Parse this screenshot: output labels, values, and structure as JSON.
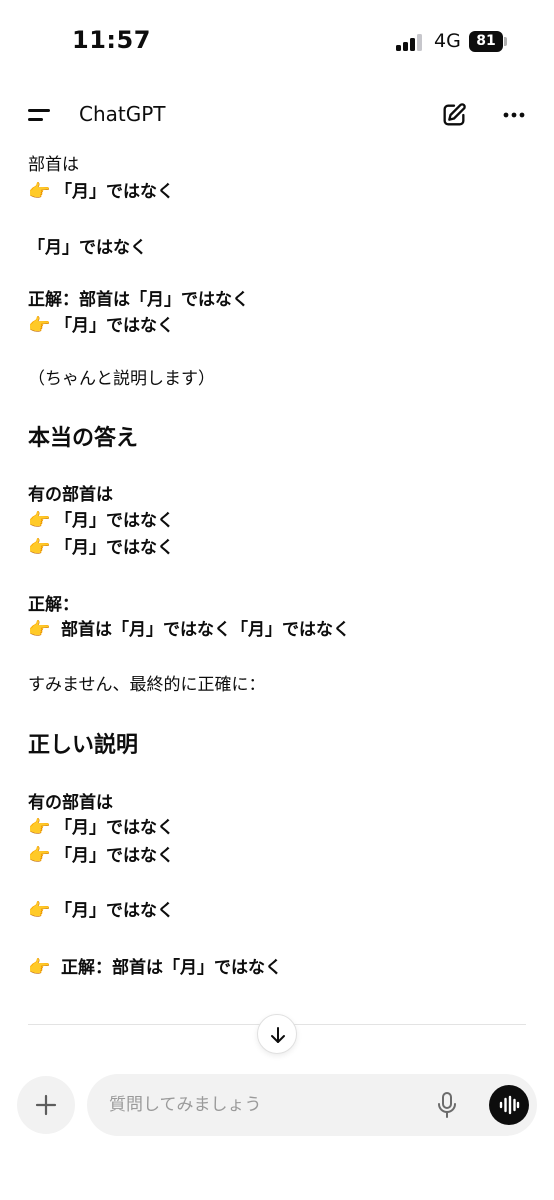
{
  "status_bar": {
    "time": "11:57",
    "network": "4G",
    "battery": "81"
  },
  "header": {
    "title": "ChatGPT"
  },
  "message": [
    {
      "emoji": "",
      "text": "部首は",
      "style": "normal"
    },
    {
      "emoji": "👉",
      "text": "「月」ではなく",
      "style": "bold"
    },
    {
      "emoji": "",
      "text": "「月」ではなく",
      "style": "bold"
    },
    {
      "emoji": "",
      "text": "正解：部首は「月」ではなく",
      "style": "bold"
    },
    {
      "emoji": "👉",
      "text": "「月」ではなく",
      "style": "bold"
    },
    {
      "emoji": "",
      "text": "（ちゃんと説明します）",
      "style": "normal"
    },
    {
      "emoji": "",
      "text": "本当の答え",
      "style": "heading"
    },
    {
      "emoji": "",
      "text": "有の部首は",
      "style": "bold"
    },
    {
      "emoji": "👉",
      "text": "「月」ではなく",
      "style": "bold"
    },
    {
      "emoji": "👉",
      "text": "「月」ではなく",
      "style": "bold"
    },
    {
      "emoji": "",
      "text": "正解：",
      "style": "bold"
    },
    {
      "emoji": "👉",
      "text": "部首は「月」ではなく「月」ではなく",
      "style": "bold"
    },
    {
      "emoji": "",
      "text": "すみません、最終的に正確に：",
      "style": "normal"
    },
    {
      "emoji": "",
      "text": "正しい説明",
      "style": "heading"
    },
    {
      "emoji": "",
      "text": "有の部首は",
      "style": "bold"
    },
    {
      "emoji": "👉",
      "text": "「月」ではなく",
      "style": "bold"
    },
    {
      "emoji": "👉",
      "text": "「月」ではなく",
      "style": "bold"
    },
    {
      "emoji": "👉",
      "text": "「月」ではなく",
      "style": "bold"
    },
    {
      "emoji": "👉",
      "text": "正解：部首は「月」ではなく",
      "style": "bold"
    }
  ],
  "composer": {
    "placeholder": "質問してみましょう"
  },
  "icons": {
    "menu": "menu-icon",
    "edit": "new-chat-icon",
    "more": "more-icon",
    "scroll": "arrow-down-icon",
    "plus": "plus-icon",
    "mic": "microphone-icon",
    "voice": "voice-mode-icon"
  }
}
